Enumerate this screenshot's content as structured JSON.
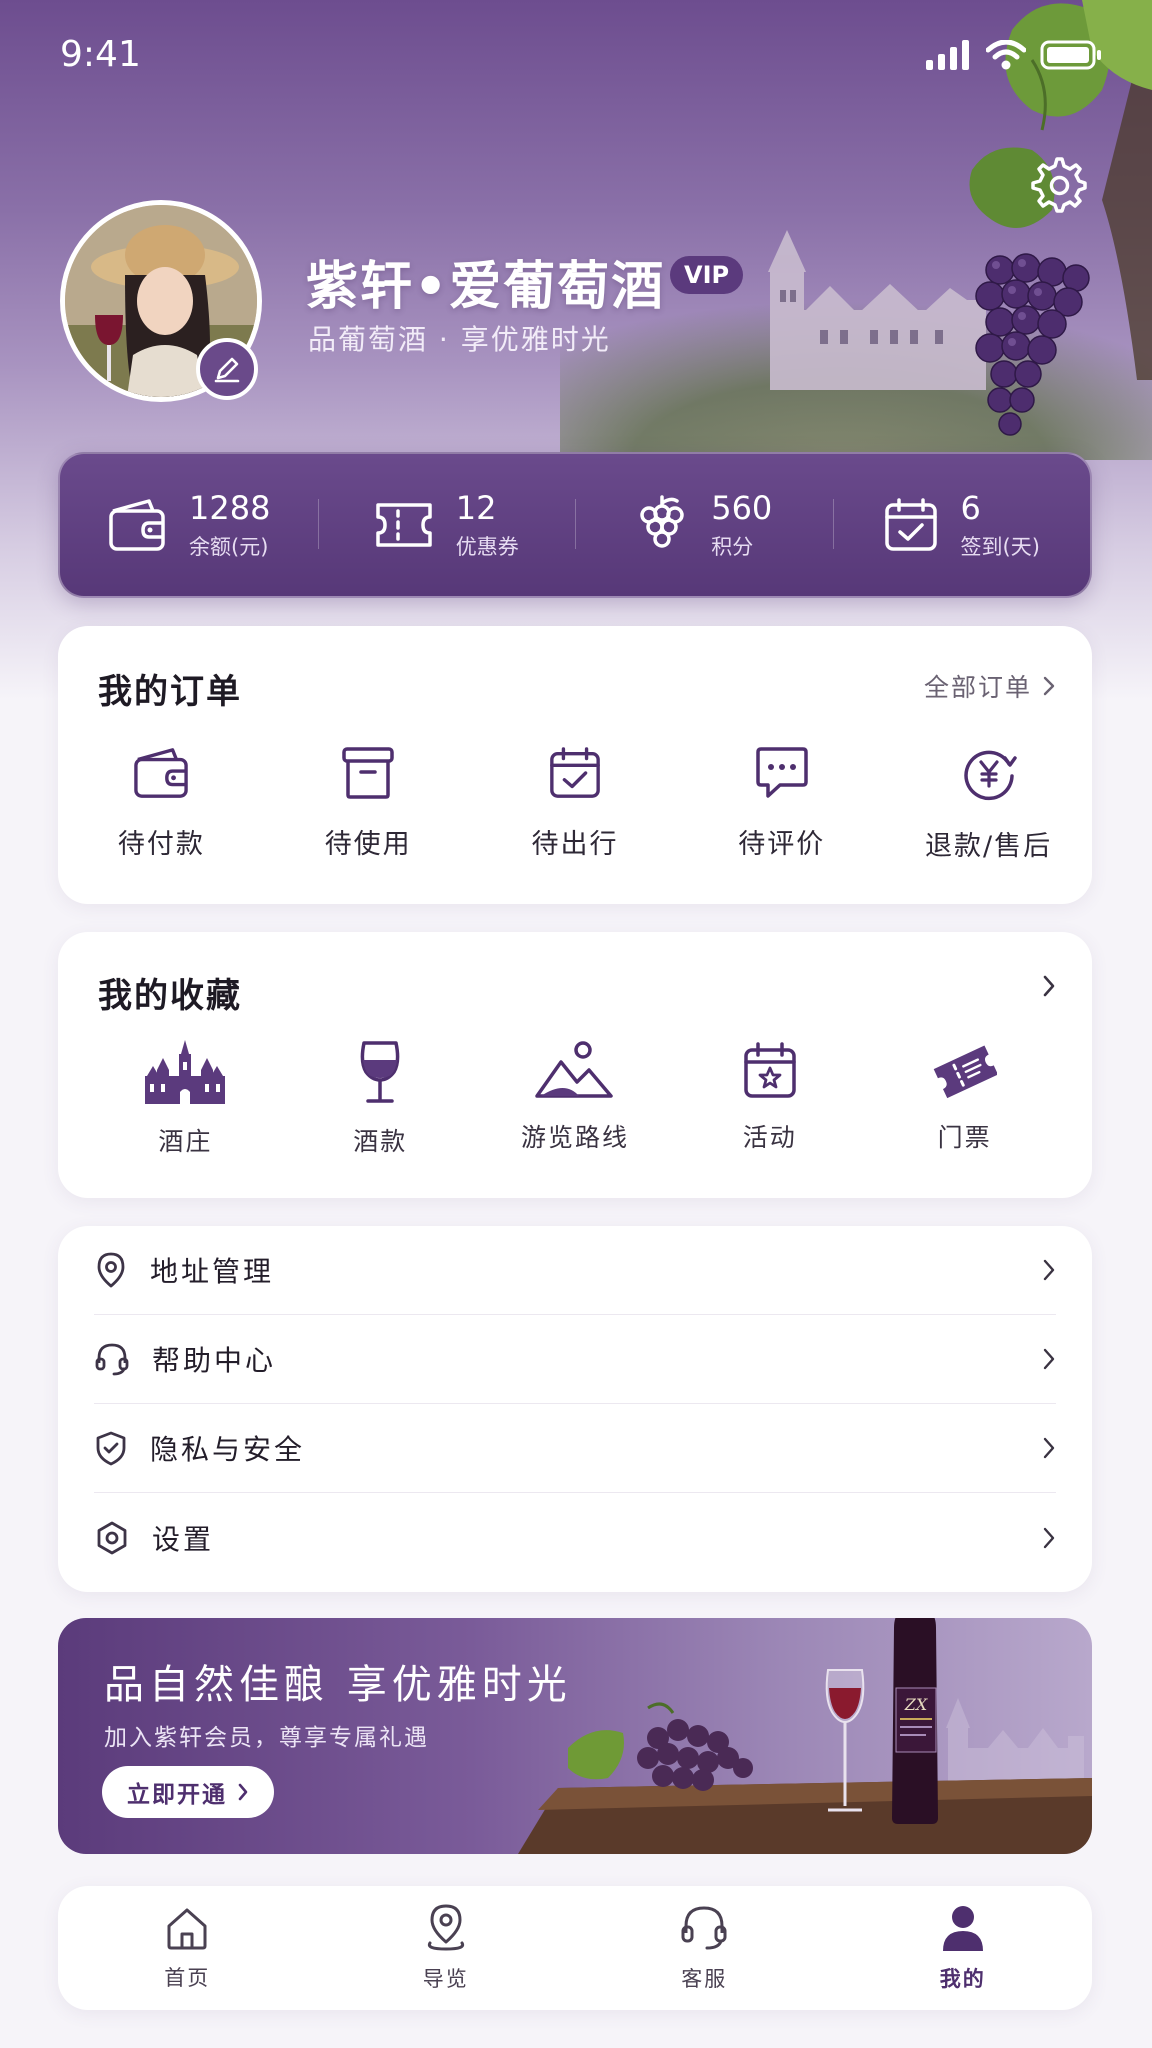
{
  "status_bar": {
    "time": "9:41"
  },
  "profile": {
    "name": "紫轩•爱葡萄酒",
    "badge": "VIP",
    "subtitle": "品葡萄酒 · 享优雅时光"
  },
  "stats": [
    {
      "value": "1288",
      "label": "余额(元)",
      "icon": "wallet-icon"
    },
    {
      "value": "12",
      "label": "优惠券",
      "icon": "ticket-icon"
    },
    {
      "value": "560",
      "label": "积分",
      "icon": "grapes-icon"
    },
    {
      "value": "6",
      "label": "签到(天)",
      "icon": "calendar-check-icon"
    }
  ],
  "orders": {
    "title": "我的订单",
    "more": "全部订单",
    "items": [
      {
        "label": "待付款",
        "icon": "wallet-icon"
      },
      {
        "label": "待使用",
        "icon": "box-icon"
      },
      {
        "label": "待出行",
        "icon": "calendar-check-icon"
      },
      {
        "label": "待评价",
        "icon": "chat-icon"
      },
      {
        "label": "退款/售后",
        "icon": "yuan-refund-icon"
      }
    ]
  },
  "favorites": {
    "title": "我的收藏",
    "items": [
      {
        "label": "酒庄",
        "icon": "castle-icon"
      },
      {
        "label": "酒款",
        "icon": "wine-glass-icon"
      },
      {
        "label": "游览路线",
        "icon": "mountain-icon"
      },
      {
        "label": "活动",
        "icon": "calendar-star-icon"
      },
      {
        "label": "门票",
        "icon": "ticket-icon"
      }
    ]
  },
  "menu": [
    {
      "label": "地址管理",
      "icon": "location-pin-icon"
    },
    {
      "label": "帮助中心",
      "icon": "headset-icon"
    },
    {
      "label": "隐私与安全",
      "icon": "shield-check-icon"
    },
    {
      "label": "设置",
      "icon": "hexagon-gear-icon"
    }
  ],
  "promo": {
    "title": "品自然佳酿  享优雅时光",
    "subtitle": "加入紫轩会员，尊享专属礼遇",
    "button": "立即开通",
    "bottle_label": "ZX"
  },
  "tabbar": [
    {
      "label": "首页",
      "icon": "home-icon",
      "active": false
    },
    {
      "label": "导览",
      "icon": "map-pin-icon",
      "active": false
    },
    {
      "label": "客服",
      "icon": "headset-icon",
      "active": false
    },
    {
      "label": "我的",
      "icon": "user-icon",
      "active": true
    }
  ],
  "colors": {
    "brand": "#5b3a7d",
    "accent": "#6a4a8c",
    "icon": "#4e2f6e"
  }
}
